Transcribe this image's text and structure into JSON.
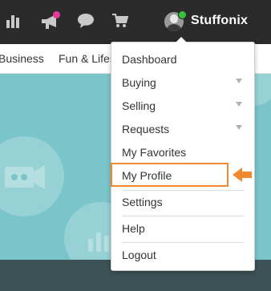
{
  "header": {
    "username": "Stuffonix",
    "icons": [
      "bar-chart-icon",
      "megaphone-icon",
      "chat-bubble-icon",
      "shopping-cart-icon"
    ],
    "notify_color": "#e6399b",
    "online_color": "#35c435"
  },
  "categories": {
    "items": [
      {
        "label": "Business"
      },
      {
        "label": "Fun & Lifes"
      }
    ]
  },
  "menu": {
    "items": [
      {
        "label": "Dashboard",
        "has_submenu": false
      },
      {
        "label": "Buying",
        "has_submenu": true
      },
      {
        "label": "Selling",
        "has_submenu": true
      },
      {
        "label": "Requests",
        "has_submenu": true
      },
      {
        "label": "My Favorites",
        "has_submenu": false
      },
      {
        "label": "My Profile",
        "has_submenu": false,
        "highlighted": true
      },
      {
        "label": "Settings",
        "has_submenu": false
      },
      {
        "label": "Help",
        "has_submenu": false
      },
      {
        "label": "Logout",
        "has_submenu": false
      }
    ],
    "highlight_color": "#f0892e"
  }
}
